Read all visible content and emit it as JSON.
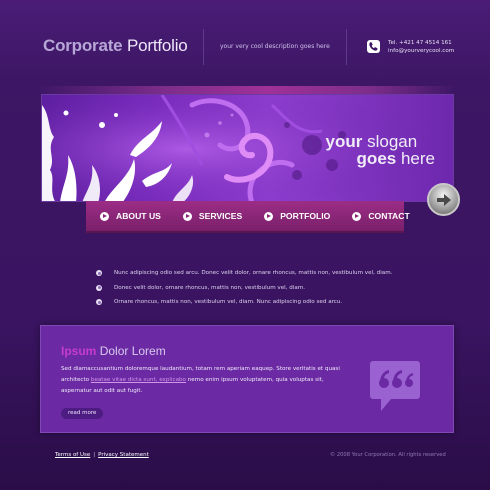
{
  "header": {
    "logo_part1": "Corporate",
    "logo_part2": "Portfolio",
    "description": "your very cool description goes here",
    "phone": "Tel. +421 47 4514 161",
    "email": "info@yourverycool.com",
    "phone_icon": "phone-icon"
  },
  "banner": {
    "slogan_line1_bold": "your",
    "slogan_line1_rest": "slogan",
    "slogan_line2_bold": "goes",
    "slogan_line2_rest": "here",
    "arrow_icon": "arrow-right-icon"
  },
  "nav": {
    "items": [
      {
        "label": "ABOUT US"
      },
      {
        "label": "SERVICES"
      },
      {
        "label": "PORTFOLIO"
      },
      {
        "label": "CONTACT"
      }
    ]
  },
  "bullets": [
    "Nunc adipiscing odio sed arcu. Donec velit dolor, ornare rhoncus, mattis non, vestibulum vel, diam.",
    "Donec velit dolor, ornare rhoncus, mattis non, vestibulum vel, diam.",
    "Ornare rhoncus, mattis non, vestibulum vel, diam. Nunc adipiscing odio sed arcu."
  ],
  "panel": {
    "title_highlight": "Ipsum",
    "title_rest": "Dolor Lorem",
    "text_line1": "Sed diamaccusantium doloremque laudantium, totam rem aperiam eaquep. Store veritatis et quasi",
    "text_line2_pre": "architecto ",
    "text_link": "beatae vitae dicta sunt, explicabo",
    "text_line2_post": " nemo enim ipsum voluptatem, quia voluptas sit,",
    "text_line3": "aspernatur aut odit aut fugit.",
    "read_more": "read more",
    "quote_icon": "speech-bubble-quote-icon"
  },
  "footer": {
    "terms": "Terms of Use",
    "divider": "|",
    "privacy": "Privacy Statement",
    "copyright": "© 2008 Your Corporation. All rights reserved"
  },
  "colors": {
    "background": "#3b1562",
    "nav": "#9c2d86",
    "panel": "#6b2aa3",
    "accent": "#c63bd0"
  }
}
